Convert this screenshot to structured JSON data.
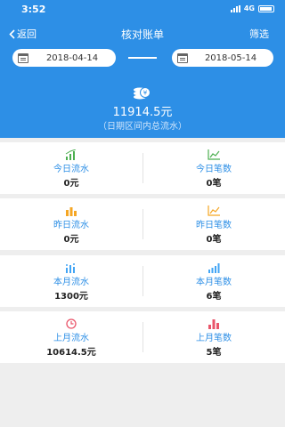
{
  "status": {
    "time": "3:52",
    "network": "4G"
  },
  "nav": {
    "back_label": "返回",
    "title": "核对账单",
    "filter_label": "筛选"
  },
  "dates": {
    "start": "2018-04-14",
    "end": "2018-05-14"
  },
  "summary": {
    "total": "11914.5元",
    "caption": "（日期区间内总流水）"
  },
  "cards": [
    {
      "left": {
        "label": "今日流水",
        "value": "0元",
        "icon": "bar-chart-green-icon"
      },
      "right": {
        "label": "今日笔数",
        "value": "0笔",
        "icon": "line-chart-green-icon"
      }
    },
    {
      "left": {
        "label": "昨日流水",
        "value": "0元",
        "icon": "bar-chart-orange-icon"
      },
      "right": {
        "label": "昨日笔数",
        "value": "0笔",
        "icon": "line-chart-orange-icon"
      }
    },
    {
      "left": {
        "label": "本月流水",
        "value": "1300元",
        "icon": "bar-chart-blue-icon"
      },
      "right": {
        "label": "本月笔数",
        "value": "6笔",
        "icon": "bar-chart-blue-icon"
      }
    },
    {
      "left": {
        "label": "上月流水",
        "value": "10614.5元",
        "icon": "clock-red-icon"
      },
      "right": {
        "label": "上月笔数",
        "value": "5笔",
        "icon": "bar-chart-red-icon"
      }
    }
  ],
  "colors": {
    "header": "#2d8fe6",
    "label": "#2d8fe6",
    "green": "#4caf50",
    "orange": "#f5a623",
    "blue": "#42a5f5",
    "red": "#e9556a"
  }
}
